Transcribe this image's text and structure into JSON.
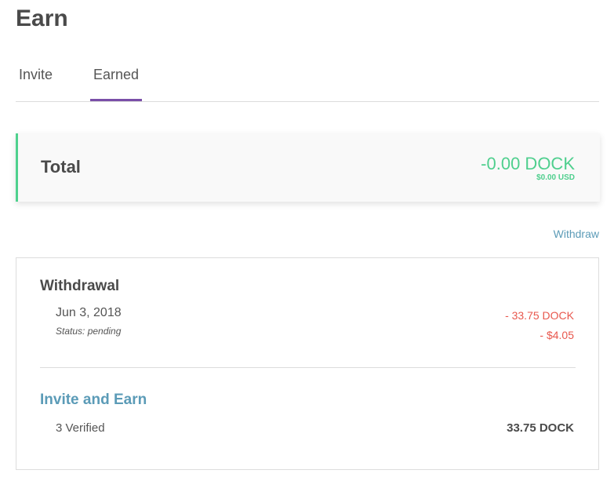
{
  "header": {
    "title": "Earn"
  },
  "tabs": [
    {
      "label": "Invite",
      "active": false
    },
    {
      "label": "Earned",
      "active": true
    }
  ],
  "total": {
    "label": "Total",
    "dock": "-0.00 DOCK",
    "usd": "$0.00 USD"
  },
  "actions": {
    "withdraw_label": "Withdraw"
  },
  "history": {
    "withdrawal": {
      "title": "Withdrawal",
      "date": "Jun 3, 2018",
      "status": "Status: pending",
      "dock": "- 33.75 DOCK",
      "usd": "- $4.05"
    },
    "invite": {
      "title": "Invite and Earn",
      "verified": "3 Verified",
      "amount": "33.75 DOCK"
    }
  },
  "colors": {
    "accent_tab": "#7a4fa8",
    "positive": "#4fcf8e",
    "negative": "#e8574d",
    "link": "#5b9bb7"
  }
}
